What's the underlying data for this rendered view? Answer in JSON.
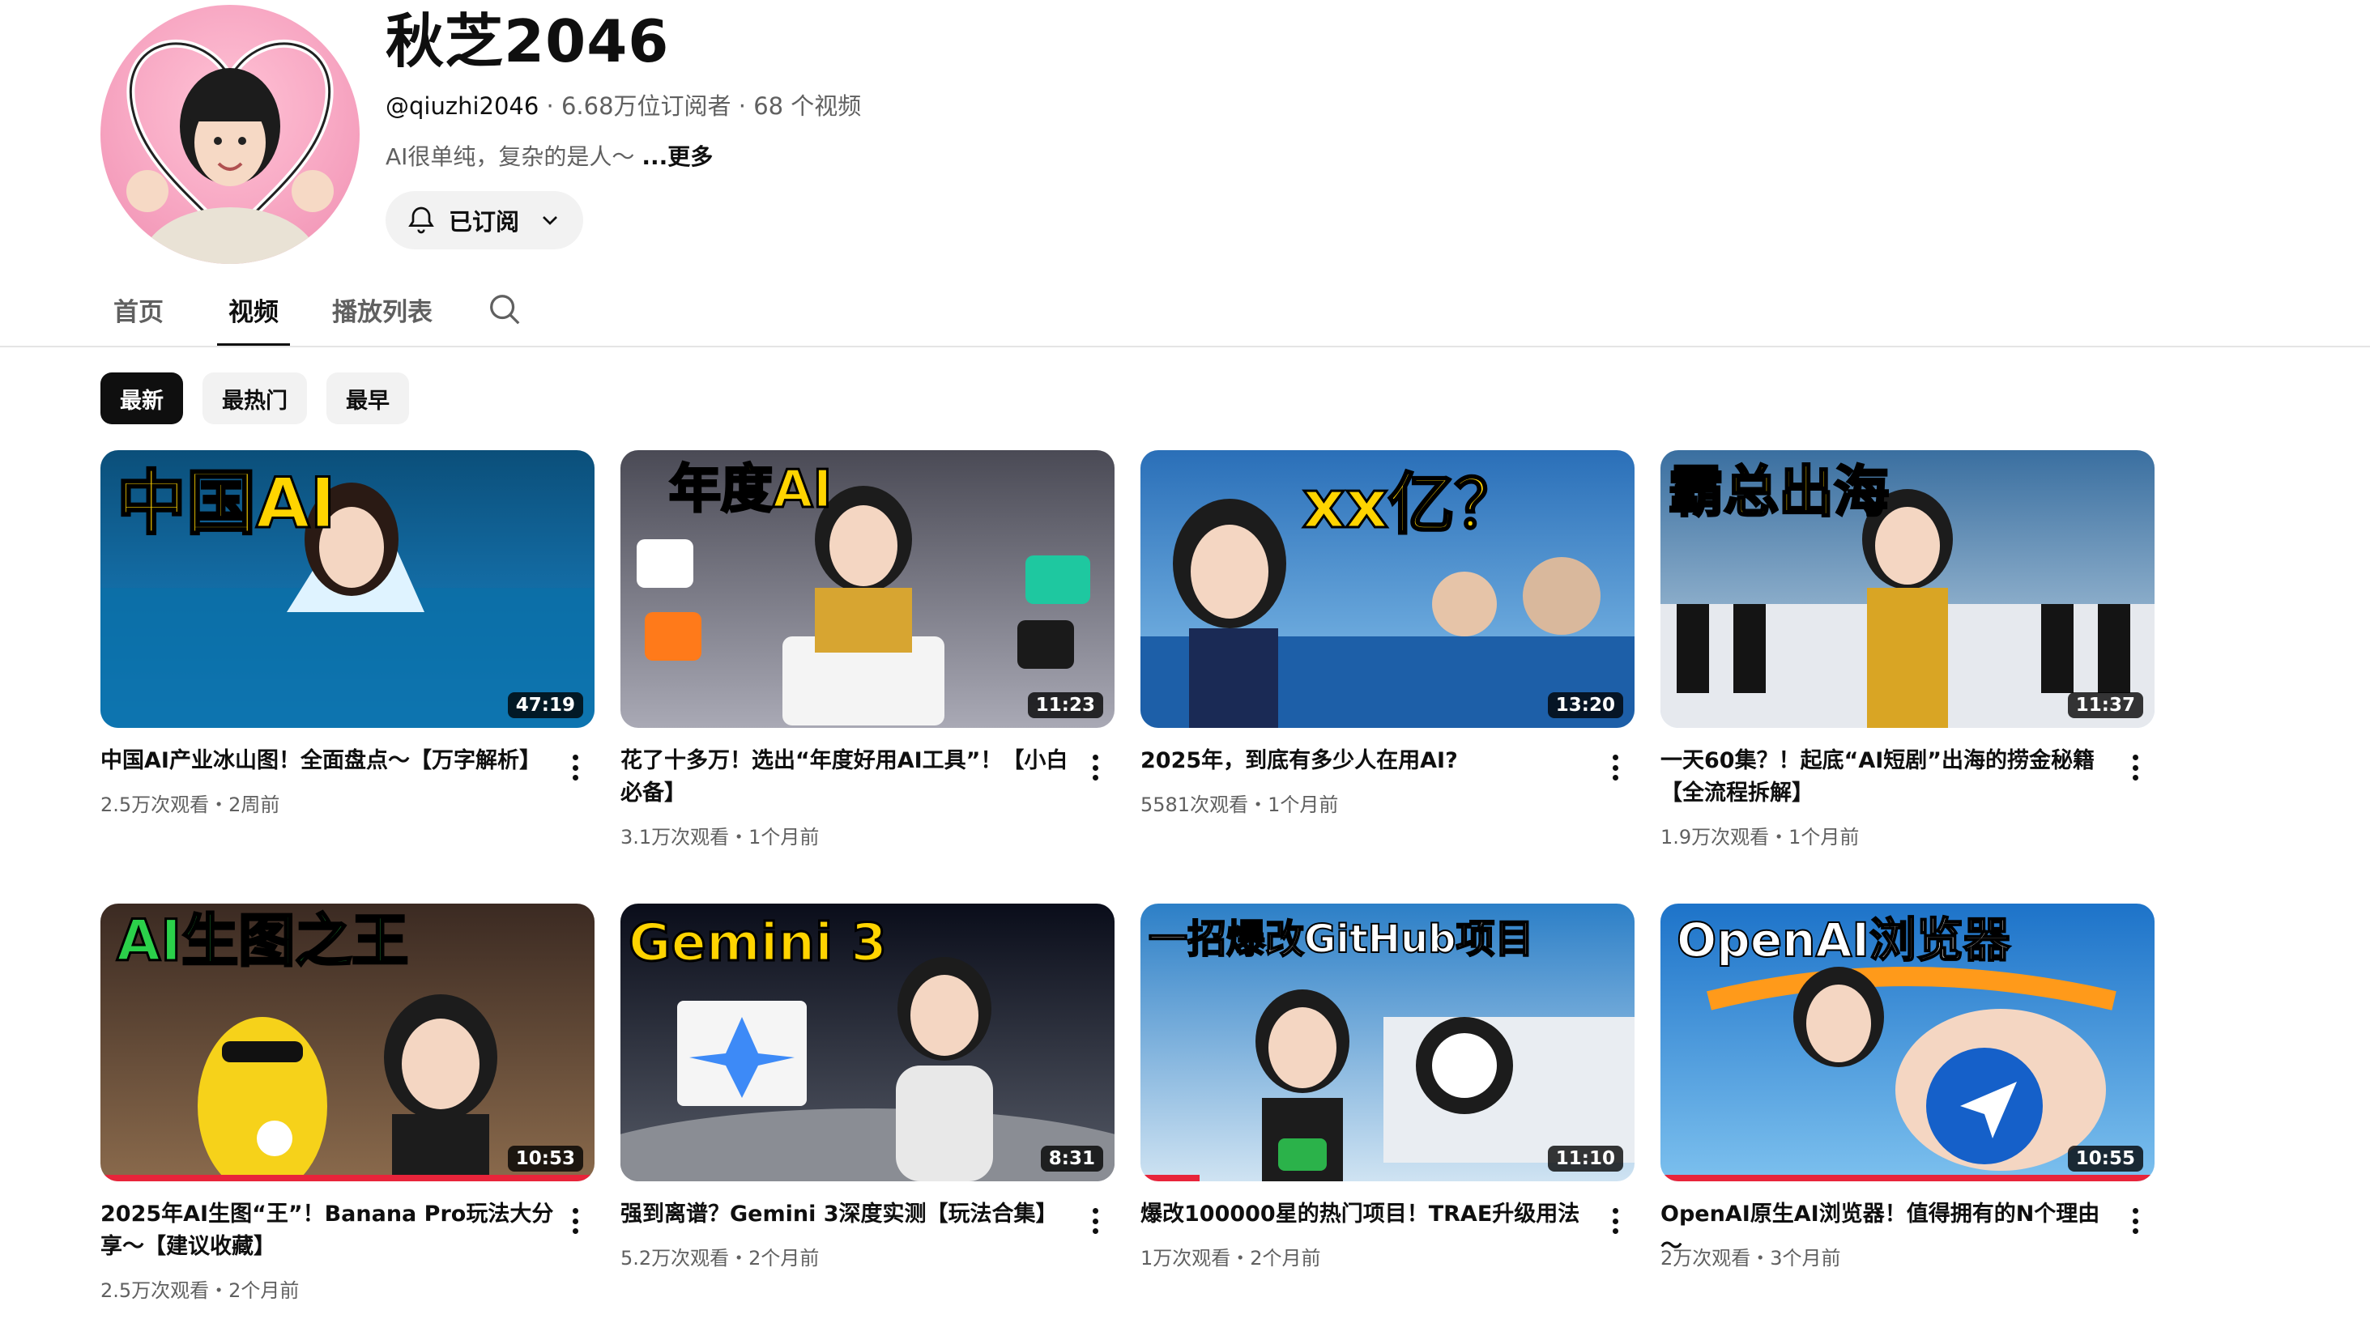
{
  "channel": {
    "name": "秋芝2046",
    "handle": "@qiuzhi2046",
    "meta": " · 6.68万位订阅者 · 68 个视频",
    "description": "AI很单纯，复杂的是人～ ",
    "more_label": "...更多",
    "subscribe_label": "已订阅"
  },
  "tabs": [
    {
      "label": "首页",
      "active": false
    },
    {
      "label": "视频",
      "active": true
    },
    {
      "label": "播放列表",
      "active": false
    }
  ],
  "chips": [
    {
      "label": "最新",
      "active": true
    },
    {
      "label": "最热门",
      "active": false
    },
    {
      "label": "最早",
      "active": false
    }
  ],
  "videos": [
    {
      "thumb_text": "中国AI",
      "thumb_colors": [
        "#0b4f7a",
        "#1c8ad0"
      ],
      "duration": "47:19",
      "title": "中国AI产业冰山图！全面盘点～【万字解析】",
      "stats": "2.5万次观看・2周前",
      "watched": false
    },
    {
      "thumb_text": "年度AI",
      "thumb_colors": [
        "#4a4a55",
        "#a9a9b5"
      ],
      "duration": "11:23",
      "title": "花了十多万！选出“年度好用AI工具”！【小白必备】",
      "stats": "3.1万次观看・1个月前",
      "watched": false
    },
    {
      "thumb_text": "xx亿？",
      "thumb_colors": [
        "#2a6fb8",
        "#89c4ee"
      ],
      "duration": "13:20",
      "title": "2025年，到底有多少人在用AI?",
      "stats": "5581次观看・1个月前",
      "watched": false
    },
    {
      "thumb_text": "霸总出海",
      "thumb_colors": [
        "#3a6fa0",
        "#c9dcea"
      ],
      "duration": "11:37",
      "title": "一天60集？！起底“AI短剧”出海的捞金秘籍【全流程拆解】",
      "stats": "1.9万次观看・1个月前",
      "watched": false
    },
    {
      "thumb_text": "AI生图之王",
      "thumb_colors": [
        "#3b2a22",
        "#8a6a4c"
      ],
      "duration": "10:53",
      "title": "2025年AI生图“王”！Banana Pro玩法大分享～【建议收藏】",
      "stats": "2.5万次观看・2个月前",
      "watched": true
    },
    {
      "thumb_text": "Gemini 3",
      "thumb_colors": [
        "#0a0d1a",
        "#555a66"
      ],
      "duration": "8:31",
      "title": "强到离谱？Gemini 3深度实测【玩法合集】",
      "stats": "5.2万次观看・2个月前",
      "watched": false
    },
    {
      "thumb_text": "一招爆改GitHub项目",
      "thumb_colors": [
        "#2c7fc7",
        "#cfe3f2"
      ],
      "duration": "11:10",
      "title": "爆改100000星的热门项目！TRAE升级用法",
      "stats": "1万次观看・2个月前",
      "watched": true
    },
    {
      "thumb_text": "OpenAI浏览器",
      "thumb_colors": [
        "#1d73c9",
        "#7cc0ee"
      ],
      "duration": "10:55",
      "title": "OpenAI原生AI浏览器！值得拥有的N个理由～",
      "stats": "2万次观看・3个月前",
      "watched": true
    }
  ]
}
